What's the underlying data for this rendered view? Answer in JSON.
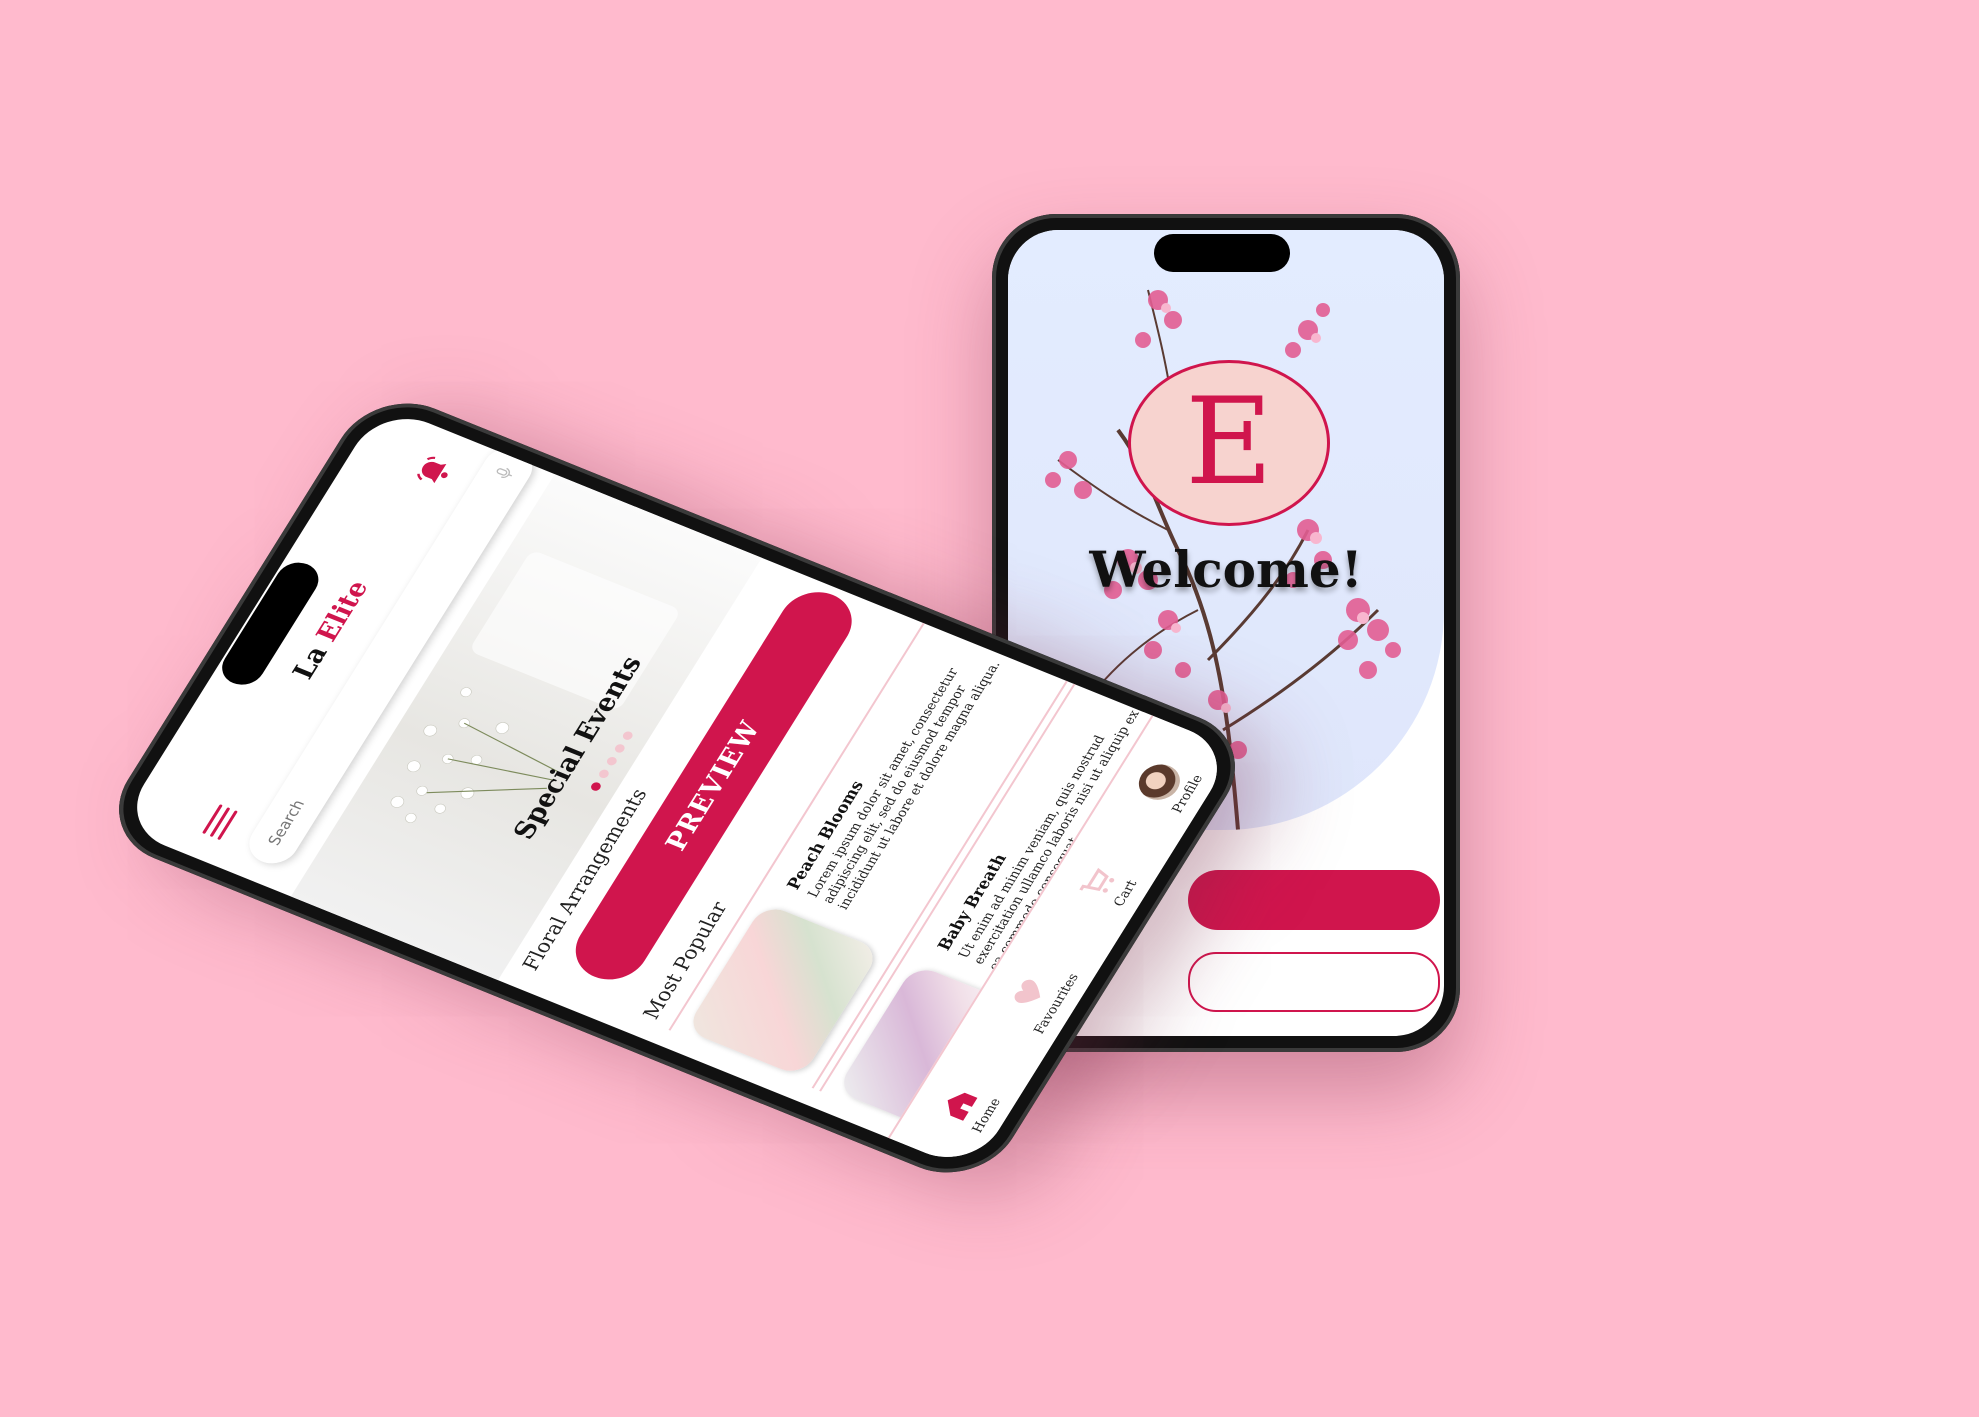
{
  "welcome": {
    "logo_letter": "E",
    "title": "Welcome!",
    "primary_button": "",
    "secondary_button": ""
  },
  "home": {
    "app_name_a": "La ",
    "app_name_b": "Elite",
    "search": {
      "placeholder": "Search"
    },
    "banner": {
      "title": "Special Events",
      "dots": 5,
      "active_dot": 0
    },
    "section_floral": "Floral Arrangements",
    "preview_button": "PREVIEW",
    "section_popular": "Most Popular",
    "products": [
      {
        "name": "Peach Blooms",
        "description": "Lorem ipsum dolor sit amet, consectetur adipiscing elit, sed do eiusmod tempor incididunt ut labore et dolore magna aliqua."
      },
      {
        "name": "Baby Breath",
        "description": "Ut enim ad minim veniam, quis nostrud exercitation ullamco laboris nisi ut aliquip ex ea commodo consequat."
      }
    ],
    "nav": [
      {
        "label": "Home",
        "icon": "home-icon"
      },
      {
        "label": "Favourites",
        "icon": "heart-icon"
      },
      {
        "label": "Cart",
        "icon": "cart-icon"
      },
      {
        "label": "Profile",
        "icon": "avatar"
      }
    ]
  },
  "colors": {
    "background": "#ffbacd",
    "accent": "#d0154d",
    "soft_pink": "#f3c6cf"
  }
}
